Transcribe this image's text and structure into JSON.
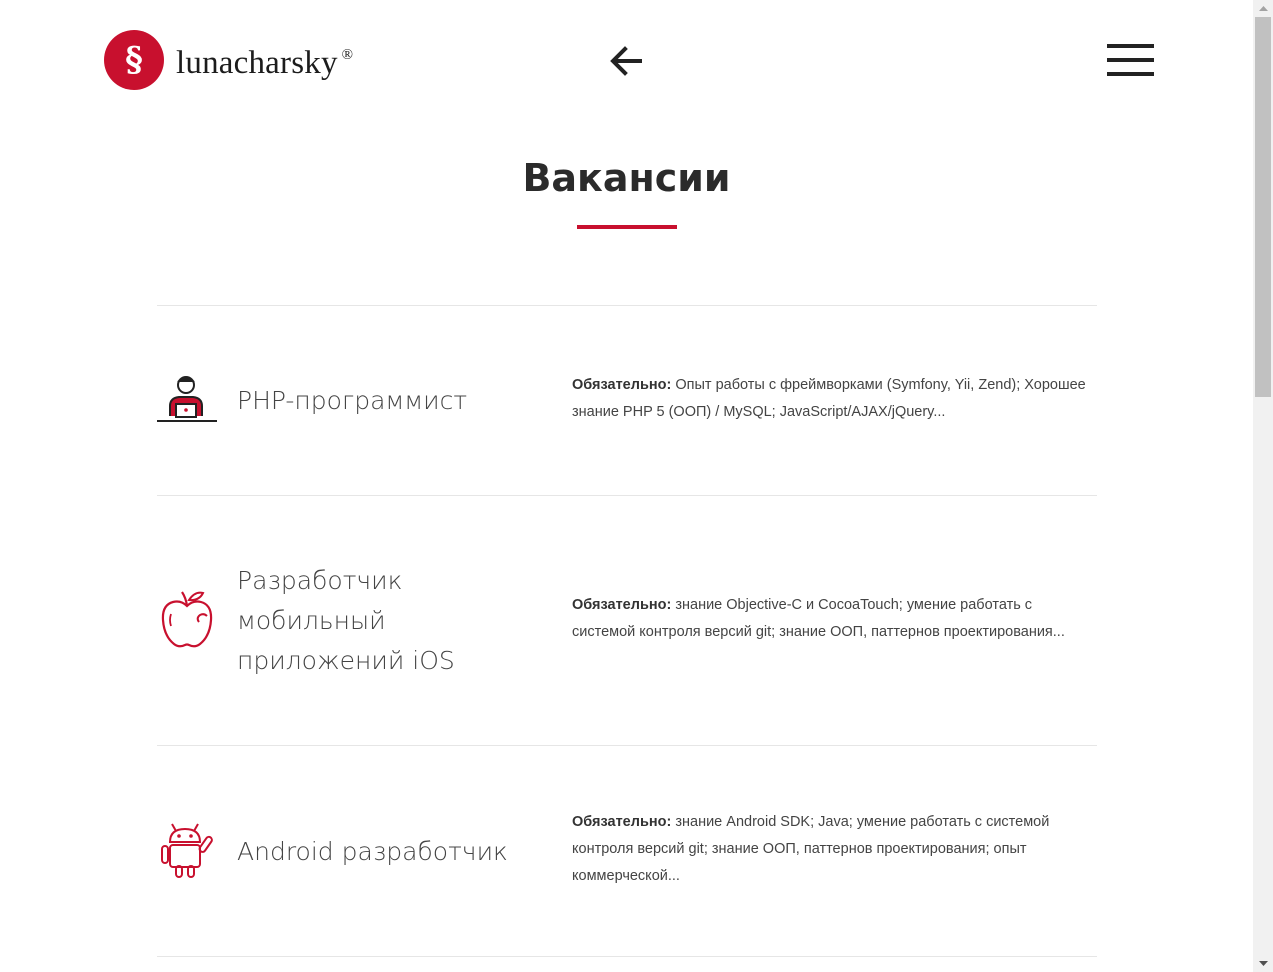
{
  "header": {
    "logo_mark": "§",
    "logo_text": "lunacharsky",
    "logo_reg": "®"
  },
  "page_title": "Вакансии",
  "jobs": [
    {
      "title": "PHP-программист",
      "required_label": "Обязательно:",
      "description": " Опыт работы с фреймворками (Symfony, Yii, Zend); Хорошее знание PHP 5 (ООП) / MySQL; JavaScript/AJAX/jQuery..."
    },
    {
      "title": "Разработчик мобильный приложений iOS",
      "required_label": "Обязательно:",
      "description": " знание Objective-C и CocoaTouch; умение работать с системой контроля версий git; знание ООП, паттернов проектирования..."
    },
    {
      "title": "Android разработчик",
      "required_label": "Обязательно:",
      "description": " знание Android SDK; Java; умение работать с системой контроля версий git; знание ООП, паттернов проектирования; опыт коммерческой..."
    }
  ],
  "colors": {
    "accent": "#c8102e",
    "text": "#444444",
    "divider": "#e6e6e6"
  },
  "icons": {
    "back": "arrow-left-icon",
    "menu": "hamburger-icon",
    "job_0": "programmer-icon",
    "job_1": "apple-icon",
    "job_2": "android-icon"
  }
}
